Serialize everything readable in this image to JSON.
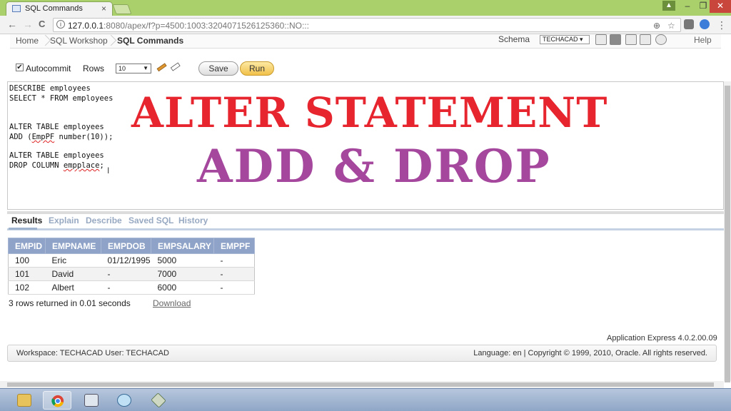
{
  "browser": {
    "tab_title": "SQL Commands",
    "tab_close": "×",
    "url_host": "127.0.0.1",
    "url_rest": ":8080/apex/f?p=4500:1003:3204071526125360::NO:::",
    "window_controls": {
      "minimize": "–",
      "maximize": "❐",
      "close": "✕"
    }
  },
  "nav_glyphs": {
    "back": "←",
    "forward": "→",
    "reload": "C",
    "info": "i",
    "zoom": "⊕",
    "star": "☆"
  },
  "apex_header": {
    "breadcrumbs": [
      "Home",
      "SQL Workshop",
      "SQL Commands"
    ],
    "schema_label": "Schema",
    "schema_value": "TECHACAD",
    "help": "Help"
  },
  "toolbar": {
    "autocommit_label": "Autocommit",
    "autocommit_checked": "✔",
    "rows_label": "Rows",
    "rows_value": "10",
    "save_label": "Save",
    "run_label": "Run"
  },
  "editor": {
    "lines": [
      "DESCRIBE employees",
      "SELECT * FROM employees",
      "",
      "",
      "ALTER TABLE employees",
      "ADD (",
      "",
      "ALTER TABLE employees",
      "DROP COLUMN "
    ],
    "line6_word": "EmpPF",
    "line6_rest": " number(10));",
    "line9_word": "empplace",
    "line9_rest": ";"
  },
  "overlay": {
    "title": "ALTER STATEMENT",
    "subtitle": "ADD & DROP",
    "title_color": "#e7252f",
    "subtitle_color": "#a4479d"
  },
  "result_tabs": [
    "Results",
    "Explain",
    "Describe",
    "Saved SQL",
    "History"
  ],
  "results": {
    "columns": [
      "EMPID",
      "EMPNAME",
      "EMPDOB",
      "EMPSALARY",
      "EMPPF"
    ],
    "rows": [
      [
        "100",
        "Eric",
        "01/12/1995",
        "5000",
        "-"
      ],
      [
        "101",
        "David",
        "-",
        "7000",
        "-"
      ],
      [
        "102",
        "Albert",
        "-",
        "6000",
        "-"
      ]
    ],
    "summary": "3 rows returned in 0.01 seconds",
    "download": "Download"
  },
  "footer": {
    "version": "Application Express 4.0.2.00.09",
    "left": "Workspace: TECHACAD User: TECHACAD",
    "right": "Language: en | Copyright © 1999, 2010, Oracle. All rights reserved."
  }
}
